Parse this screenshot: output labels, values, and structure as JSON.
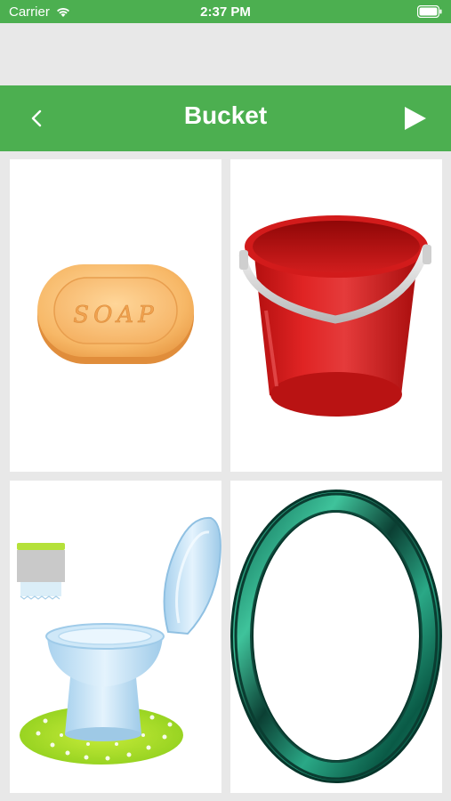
{
  "status_bar": {
    "carrier": "Carrier",
    "time": "2:37 PM"
  },
  "header": {
    "title": "Bucket",
    "back_icon": "chevron-left-icon",
    "play_icon": "play-icon"
  },
  "cards": [
    {
      "item": "soap",
      "image_text": "SOAP"
    },
    {
      "item": "bucket"
    },
    {
      "item": "toilet"
    },
    {
      "item": "ring"
    }
  ],
  "colors": {
    "accent": "#4caf50",
    "background": "#e8e8e8",
    "card": "#ffffff"
  }
}
